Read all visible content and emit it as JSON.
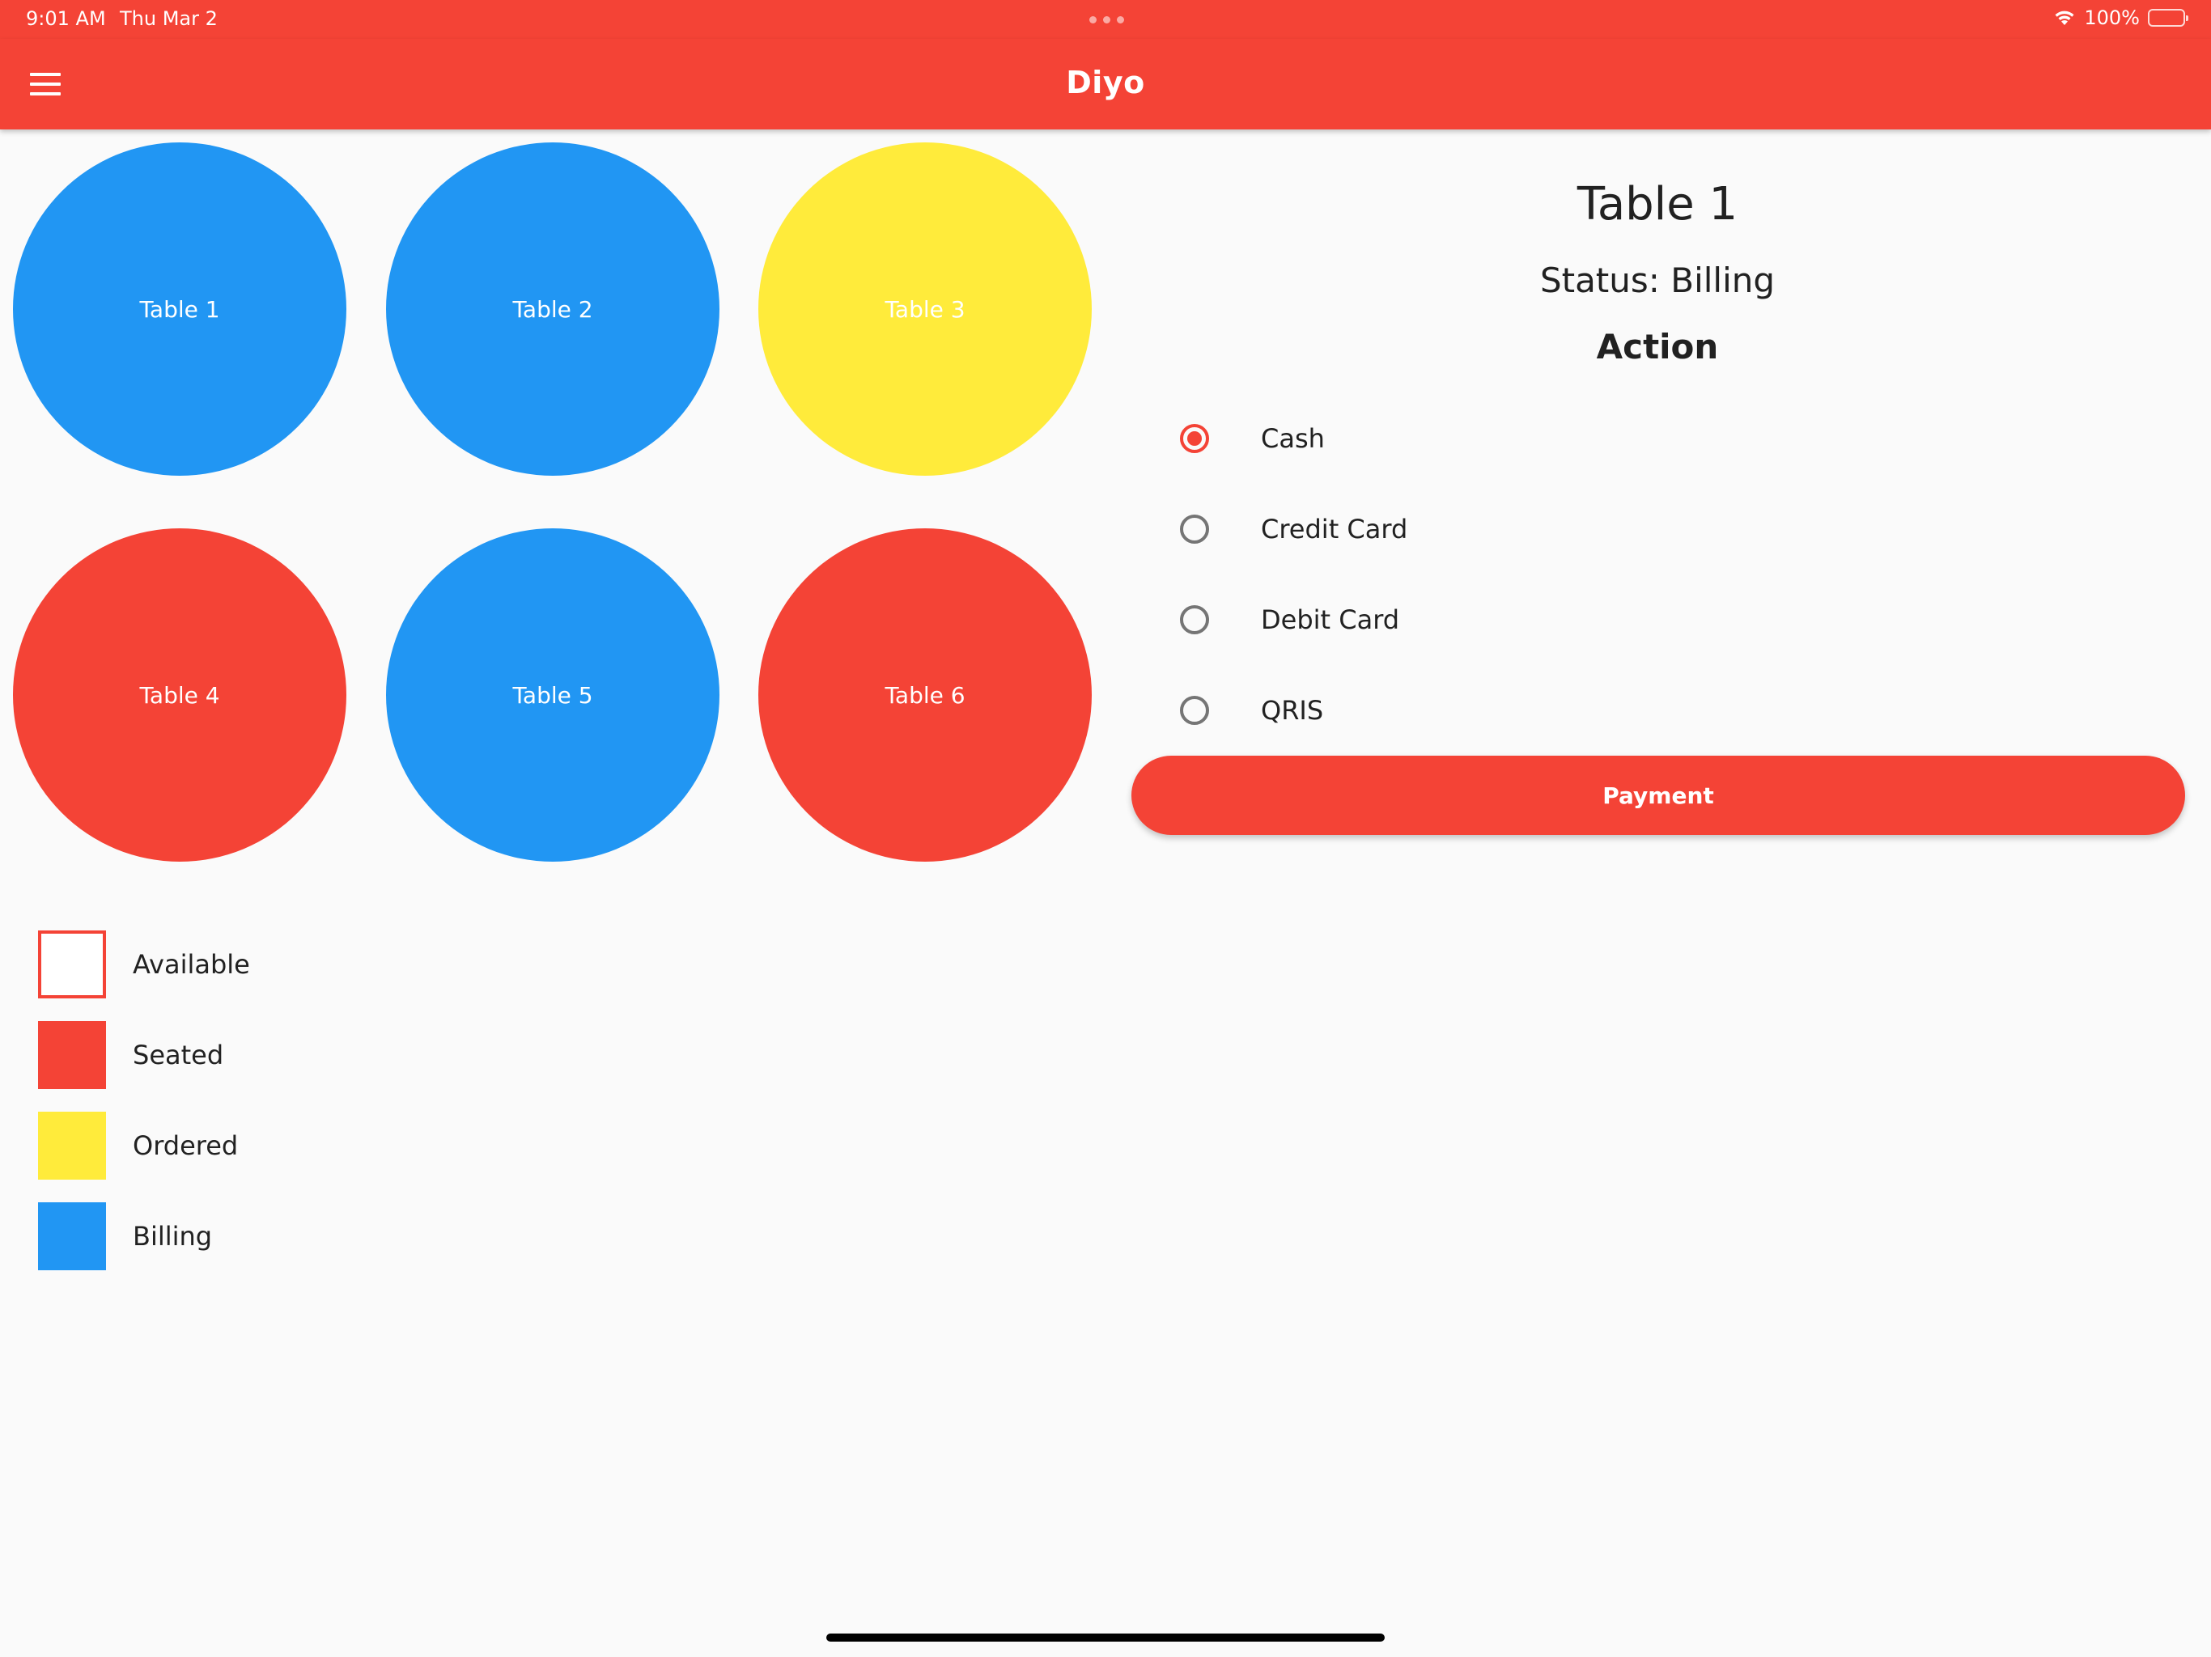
{
  "status_bar": {
    "time": "9:01 AM",
    "date": "Thu Mar 2",
    "battery": "100%",
    "wifi_icon": "wifi-icon",
    "battery_icon": "battery-icon"
  },
  "app_bar": {
    "title": "Diyo",
    "menu_icon": "hamburger-menu-icon",
    "color": "#f44336"
  },
  "tables": [
    {
      "label": "Table 1",
      "status": "Billing",
      "color": "#2196f3"
    },
    {
      "label": "Table 2",
      "status": "Billing",
      "color": "#2196f3"
    },
    {
      "label": "Table 3",
      "status": "Ordered",
      "color": "#ffeb3b"
    },
    {
      "label": "Table 4",
      "status": "Seated",
      "color": "#f44336"
    },
    {
      "label": "Table 5",
      "status": "Billing",
      "color": "#2196f3"
    },
    {
      "label": "Table 6",
      "status": "Seated",
      "color": "#f44336"
    }
  ],
  "legend": [
    {
      "label": "Available",
      "color": "#ffffff",
      "border": "#f44336"
    },
    {
      "label": "Seated",
      "color": "#f44336"
    },
    {
      "label": "Ordered",
      "color": "#ffeb3b"
    },
    {
      "label": "Billing",
      "color": "#2196f3"
    }
  ],
  "detail": {
    "title": "Table 1",
    "status": "Status: Billing",
    "action_heading": "Action",
    "payment_options": [
      {
        "label": "Cash",
        "selected": true
      },
      {
        "label": "Credit Card",
        "selected": false
      },
      {
        "label": "Debit Card",
        "selected": false
      },
      {
        "label": "QRIS",
        "selected": false
      }
    ],
    "payment_button": "Payment"
  }
}
